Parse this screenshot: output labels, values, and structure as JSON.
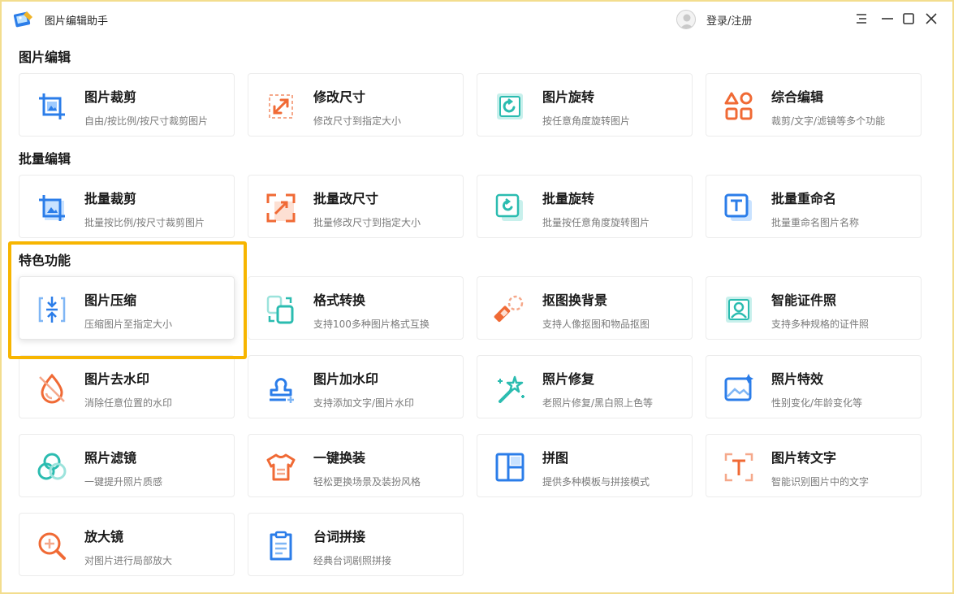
{
  "app": {
    "title": "图片编辑助手",
    "login": "登录/注册"
  },
  "colors": {
    "accent_blue": "#2b7de9",
    "accent_orange": "#f06a35",
    "accent_teal": "#2bbcb0",
    "highlight": "#f7b500"
  },
  "sections": {
    "edit": {
      "title": "图片编辑"
    },
    "batch": {
      "title": "批量编辑"
    },
    "special": {
      "title": "特色功能"
    }
  },
  "cards": {
    "crop": {
      "title": "图片裁剪",
      "desc": "自由/按比例/按尺寸裁剪图片",
      "icon": "crop-icon"
    },
    "resize": {
      "title": "修改尺寸",
      "desc": "修改尺寸到指定大小",
      "icon": "resize-icon"
    },
    "rotate": {
      "title": "图片旋转",
      "desc": "按任意角度旋转图片",
      "icon": "rotate-icon"
    },
    "combo": {
      "title": "综合编辑",
      "desc": "裁剪/文字/滤镜等多个功能",
      "icon": "shapes-icon"
    },
    "batch_crop": {
      "title": "批量裁剪",
      "desc": "批量按比例/按尺寸裁剪图片",
      "icon": "batch-crop-icon"
    },
    "batch_resize": {
      "title": "批量改尺寸",
      "desc": "批量修改尺寸到指定大小",
      "icon": "batch-resize-icon"
    },
    "batch_rotate": {
      "title": "批量旋转",
      "desc": "批量按任意角度旋转图片",
      "icon": "batch-rotate-icon"
    },
    "batch_rename": {
      "title": "批量重命名",
      "desc": "批量重命名图片名称",
      "icon": "batch-rename-icon"
    },
    "compress": {
      "title": "图片压缩",
      "desc": "压缩图片至指定大小",
      "icon": "compress-icon"
    },
    "convert": {
      "title": "格式转换",
      "desc": "支持100多种图片格式互换",
      "icon": "convert-icon"
    },
    "cutout": {
      "title": "抠图换背景",
      "desc": "支持人像抠图和物品抠图",
      "icon": "cutout-icon"
    },
    "idphoto": {
      "title": "智能证件照",
      "desc": "支持多种规格的证件照",
      "icon": "id-photo-icon"
    },
    "unwatermark": {
      "title": "图片去水印",
      "desc": "消除任意位置的水印",
      "icon": "remove-watermark-icon"
    },
    "watermark": {
      "title": "图片加水印",
      "desc": "支持添加文字/图片水印",
      "icon": "add-watermark-icon"
    },
    "repair": {
      "title": "照片修复",
      "desc": "老照片修复/黑白照上色等",
      "icon": "magic-wand-icon"
    },
    "effects": {
      "title": "照片特效",
      "desc": "性别变化/年龄变化等",
      "icon": "effects-icon"
    },
    "filter": {
      "title": "照片滤镜",
      "desc": "一键提升照片质感",
      "icon": "filter-icon"
    },
    "outfit": {
      "title": "一键换装",
      "desc": "轻松更换场景及装扮风格",
      "icon": "shirt-icon"
    },
    "collage": {
      "title": "拼图",
      "desc": "提供多种模板与拼接模式",
      "icon": "collage-icon"
    },
    "ocr": {
      "title": "图片转文字",
      "desc": "智能识别图片中的文字",
      "icon": "ocr-icon"
    },
    "magnify": {
      "title": "放大镜",
      "desc": "对图片进行局部放大",
      "icon": "magnifier-icon"
    },
    "lines": {
      "title": "台词拼接",
      "desc": "经典台词剧照拼接",
      "icon": "lines-icon"
    }
  }
}
